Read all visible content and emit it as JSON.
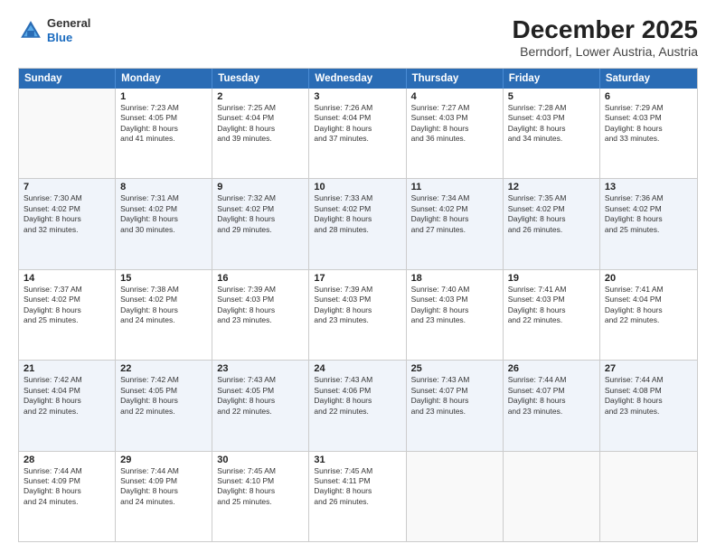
{
  "header": {
    "logo": {
      "general": "General",
      "blue": "Blue"
    },
    "title": "December 2025",
    "location": "Berndorf, Lower Austria, Austria"
  },
  "days_of_week": [
    "Sunday",
    "Monday",
    "Tuesday",
    "Wednesday",
    "Thursday",
    "Friday",
    "Saturday"
  ],
  "weeks": [
    [
      {
        "day": "",
        "sunrise": "",
        "sunset": "",
        "daylight": "",
        "empty": true
      },
      {
        "day": "1",
        "sunrise": "Sunrise: 7:23 AM",
        "sunset": "Sunset: 4:05 PM",
        "daylight": "Daylight: 8 hours",
        "daylight2": "and 41 minutes."
      },
      {
        "day": "2",
        "sunrise": "Sunrise: 7:25 AM",
        "sunset": "Sunset: 4:04 PM",
        "daylight": "Daylight: 8 hours",
        "daylight2": "and 39 minutes."
      },
      {
        "day": "3",
        "sunrise": "Sunrise: 7:26 AM",
        "sunset": "Sunset: 4:04 PM",
        "daylight": "Daylight: 8 hours",
        "daylight2": "and 37 minutes."
      },
      {
        "day": "4",
        "sunrise": "Sunrise: 7:27 AM",
        "sunset": "Sunset: 4:03 PM",
        "daylight": "Daylight: 8 hours",
        "daylight2": "and 36 minutes."
      },
      {
        "day": "5",
        "sunrise": "Sunrise: 7:28 AM",
        "sunset": "Sunset: 4:03 PM",
        "daylight": "Daylight: 8 hours",
        "daylight2": "and 34 minutes."
      },
      {
        "day": "6",
        "sunrise": "Sunrise: 7:29 AM",
        "sunset": "Sunset: 4:03 PM",
        "daylight": "Daylight: 8 hours",
        "daylight2": "and 33 minutes."
      }
    ],
    [
      {
        "day": "7",
        "sunrise": "Sunrise: 7:30 AM",
        "sunset": "Sunset: 4:02 PM",
        "daylight": "Daylight: 8 hours",
        "daylight2": "and 32 minutes."
      },
      {
        "day": "8",
        "sunrise": "Sunrise: 7:31 AM",
        "sunset": "Sunset: 4:02 PM",
        "daylight": "Daylight: 8 hours",
        "daylight2": "and 30 minutes."
      },
      {
        "day": "9",
        "sunrise": "Sunrise: 7:32 AM",
        "sunset": "Sunset: 4:02 PM",
        "daylight": "Daylight: 8 hours",
        "daylight2": "and 29 minutes."
      },
      {
        "day": "10",
        "sunrise": "Sunrise: 7:33 AM",
        "sunset": "Sunset: 4:02 PM",
        "daylight": "Daylight: 8 hours",
        "daylight2": "and 28 minutes."
      },
      {
        "day": "11",
        "sunrise": "Sunrise: 7:34 AM",
        "sunset": "Sunset: 4:02 PM",
        "daylight": "Daylight: 8 hours",
        "daylight2": "and 27 minutes."
      },
      {
        "day": "12",
        "sunrise": "Sunrise: 7:35 AM",
        "sunset": "Sunset: 4:02 PM",
        "daylight": "Daylight: 8 hours",
        "daylight2": "and 26 minutes."
      },
      {
        "day": "13",
        "sunrise": "Sunrise: 7:36 AM",
        "sunset": "Sunset: 4:02 PM",
        "daylight": "Daylight: 8 hours",
        "daylight2": "and 25 minutes."
      }
    ],
    [
      {
        "day": "14",
        "sunrise": "Sunrise: 7:37 AM",
        "sunset": "Sunset: 4:02 PM",
        "daylight": "Daylight: 8 hours",
        "daylight2": "and 25 minutes."
      },
      {
        "day": "15",
        "sunrise": "Sunrise: 7:38 AM",
        "sunset": "Sunset: 4:02 PM",
        "daylight": "Daylight: 8 hours",
        "daylight2": "and 24 minutes."
      },
      {
        "day": "16",
        "sunrise": "Sunrise: 7:39 AM",
        "sunset": "Sunset: 4:03 PM",
        "daylight": "Daylight: 8 hours",
        "daylight2": "and 23 minutes."
      },
      {
        "day": "17",
        "sunrise": "Sunrise: 7:39 AM",
        "sunset": "Sunset: 4:03 PM",
        "daylight": "Daylight: 8 hours",
        "daylight2": "and 23 minutes."
      },
      {
        "day": "18",
        "sunrise": "Sunrise: 7:40 AM",
        "sunset": "Sunset: 4:03 PM",
        "daylight": "Daylight: 8 hours",
        "daylight2": "and 23 minutes."
      },
      {
        "day": "19",
        "sunrise": "Sunrise: 7:41 AM",
        "sunset": "Sunset: 4:03 PM",
        "daylight": "Daylight: 8 hours",
        "daylight2": "and 22 minutes."
      },
      {
        "day": "20",
        "sunrise": "Sunrise: 7:41 AM",
        "sunset": "Sunset: 4:04 PM",
        "daylight": "Daylight: 8 hours",
        "daylight2": "and 22 minutes."
      }
    ],
    [
      {
        "day": "21",
        "sunrise": "Sunrise: 7:42 AM",
        "sunset": "Sunset: 4:04 PM",
        "daylight": "Daylight: 8 hours",
        "daylight2": "and 22 minutes."
      },
      {
        "day": "22",
        "sunrise": "Sunrise: 7:42 AM",
        "sunset": "Sunset: 4:05 PM",
        "daylight": "Daylight: 8 hours",
        "daylight2": "and 22 minutes."
      },
      {
        "day": "23",
        "sunrise": "Sunrise: 7:43 AM",
        "sunset": "Sunset: 4:05 PM",
        "daylight": "Daylight: 8 hours",
        "daylight2": "and 22 minutes."
      },
      {
        "day": "24",
        "sunrise": "Sunrise: 7:43 AM",
        "sunset": "Sunset: 4:06 PM",
        "daylight": "Daylight: 8 hours",
        "daylight2": "and 22 minutes."
      },
      {
        "day": "25",
        "sunrise": "Sunrise: 7:43 AM",
        "sunset": "Sunset: 4:07 PM",
        "daylight": "Daylight: 8 hours",
        "daylight2": "and 23 minutes."
      },
      {
        "day": "26",
        "sunrise": "Sunrise: 7:44 AM",
        "sunset": "Sunset: 4:07 PM",
        "daylight": "Daylight: 8 hours",
        "daylight2": "and 23 minutes."
      },
      {
        "day": "27",
        "sunrise": "Sunrise: 7:44 AM",
        "sunset": "Sunset: 4:08 PM",
        "daylight": "Daylight: 8 hours",
        "daylight2": "and 23 minutes."
      }
    ],
    [
      {
        "day": "28",
        "sunrise": "Sunrise: 7:44 AM",
        "sunset": "Sunset: 4:09 PM",
        "daylight": "Daylight: 8 hours",
        "daylight2": "and 24 minutes."
      },
      {
        "day": "29",
        "sunrise": "Sunrise: 7:44 AM",
        "sunset": "Sunset: 4:09 PM",
        "daylight": "Daylight: 8 hours",
        "daylight2": "and 24 minutes."
      },
      {
        "day": "30",
        "sunrise": "Sunrise: 7:45 AM",
        "sunset": "Sunset: 4:10 PM",
        "daylight": "Daylight: 8 hours",
        "daylight2": "and 25 minutes."
      },
      {
        "day": "31",
        "sunrise": "Sunrise: 7:45 AM",
        "sunset": "Sunset: 4:11 PM",
        "daylight": "Daylight: 8 hours",
        "daylight2": "and 26 minutes."
      },
      {
        "day": "",
        "sunrise": "",
        "sunset": "",
        "daylight": "",
        "daylight2": "",
        "empty": true
      },
      {
        "day": "",
        "sunrise": "",
        "sunset": "",
        "daylight": "",
        "daylight2": "",
        "empty": true
      },
      {
        "day": "",
        "sunrise": "",
        "sunset": "",
        "daylight": "",
        "daylight2": "",
        "empty": true
      }
    ]
  ]
}
